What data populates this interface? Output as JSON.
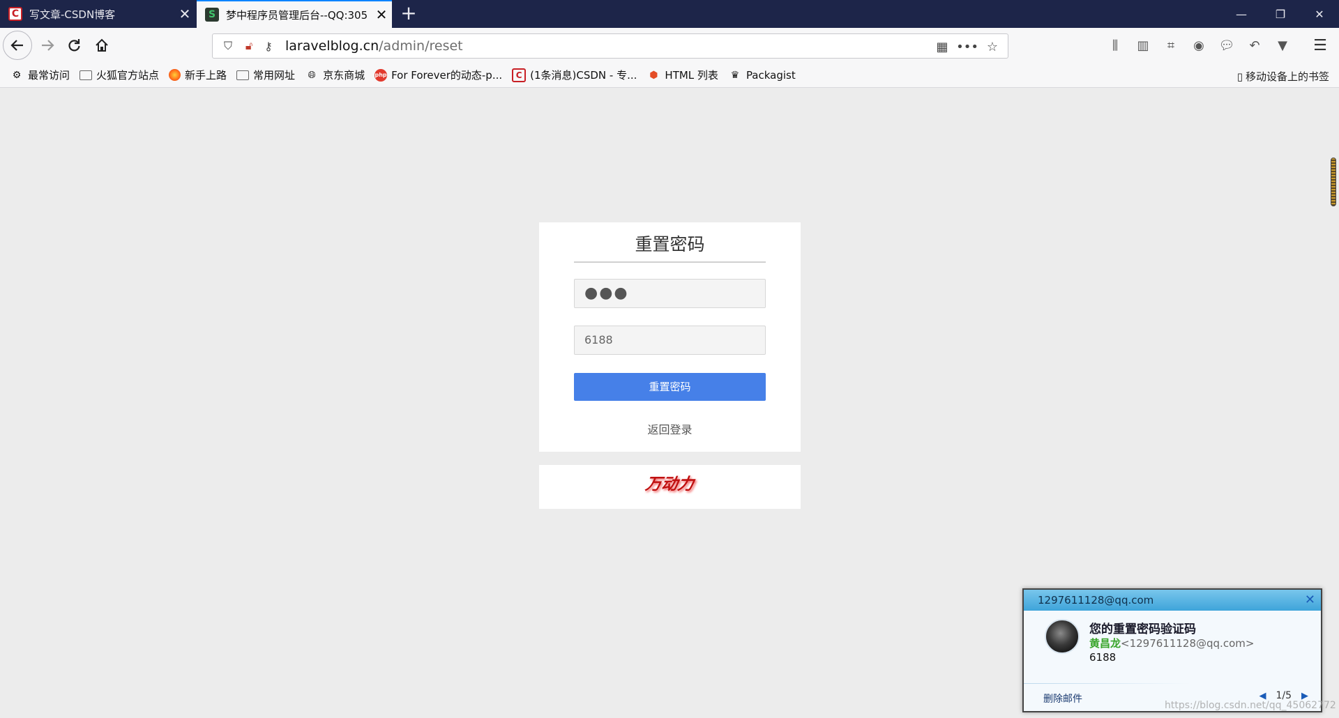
{
  "tabs": [
    {
      "title": "写文章-CSDN博客",
      "favicon": "C",
      "active": false
    },
    {
      "title": "梦中程序员管理后台--QQ:305",
      "favicon": "S",
      "active": true
    }
  ],
  "url": {
    "host": "laravelblog.cn",
    "path": "/admin/reset"
  },
  "bookmarks": [
    {
      "label": "最常访问",
      "icon": "gear-icon"
    },
    {
      "label": "火狐官方站点",
      "icon": "folder-icon"
    },
    {
      "label": "新手上路",
      "icon": "firefox-icon"
    },
    {
      "label": "常用网址",
      "icon": "folder-icon"
    },
    {
      "label": "京东商城",
      "icon": "globe-icon"
    },
    {
      "label": "For Forever的动态-p...",
      "icon": "php-icon"
    },
    {
      "label": "(1条消息)CSDN - 专...",
      "icon": "csdn-icon"
    },
    {
      "label": "HTML 列表",
      "icon": "html5-icon"
    },
    {
      "label": "Packagist",
      "icon": "packagist-icon"
    }
  ],
  "mobile_bookmarks": "移动设备上的书签",
  "form": {
    "title": "重置密码",
    "password_value": "●●●",
    "code_value": "6188",
    "submit_label": "重置密码",
    "back_link": "返回登录"
  },
  "footer": {
    "logo_text": "万动力"
  },
  "notification": {
    "account": "1297611128@qq.com",
    "subject": "您的重置密码验证码",
    "sender_name": "黄昌龙",
    "sender_email": "<1297611128@qq.com>",
    "body": "6188",
    "delete_label": "删除邮件",
    "pager": "1/5"
  },
  "watermark": "https://blog.csdn.net/qq_45062772",
  "colors": {
    "accent": "#4680e8",
    "tabstrip": "#1d2549",
    "page_bg": "#ececec"
  }
}
